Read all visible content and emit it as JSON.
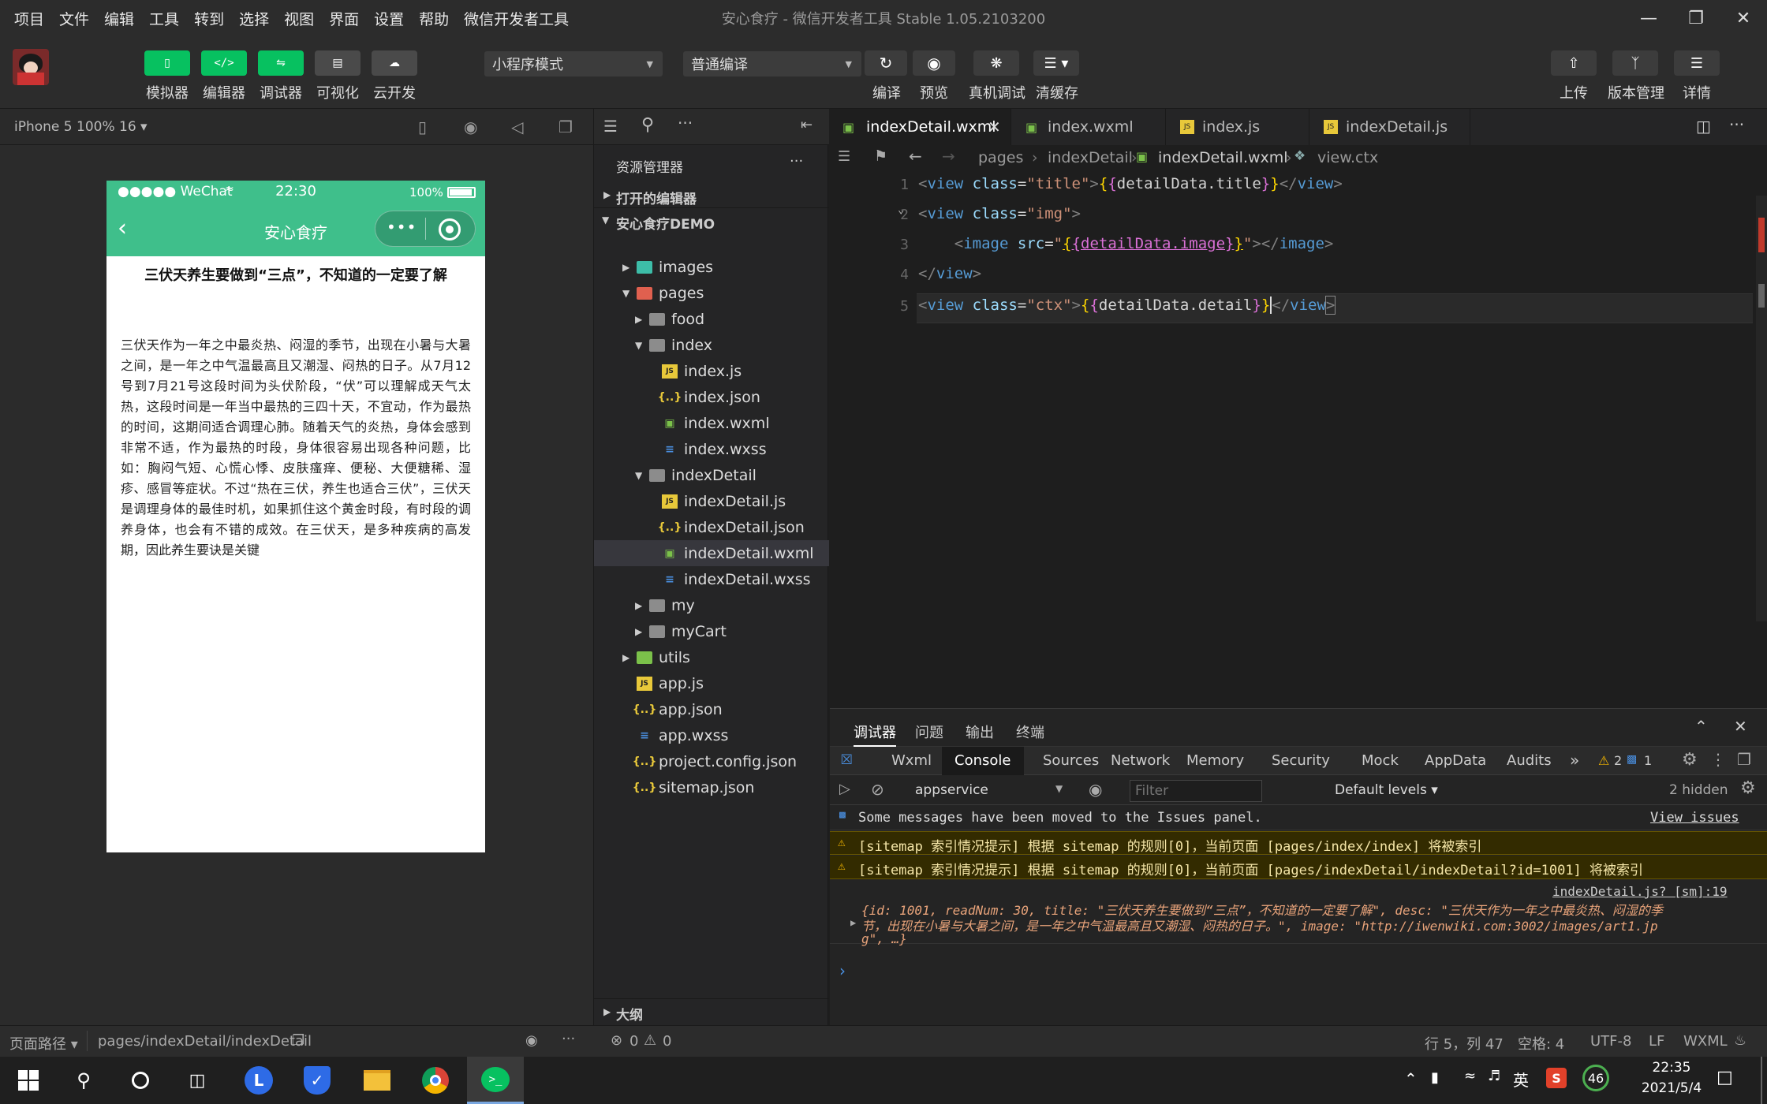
{
  "menu": [
    "项目",
    "文件",
    "编辑",
    "工具",
    "转到",
    "选择",
    "视图",
    "界面",
    "设置",
    "帮助",
    "微信开发者工具"
  ],
  "window_title": "安心食疗 - 微信开发者工具 Stable 1.05.2103200",
  "toolbar": {
    "left_buttons": [
      "模拟器",
      "编辑器",
      "调试器",
      "可视化",
      "云开发"
    ],
    "mode_select": "小程序模式",
    "compile_select": "普通编译",
    "actions": [
      "编译",
      "预览",
      "真机调试",
      "清缓存"
    ],
    "right_buttons": [
      "上传",
      "版本管理",
      "详情"
    ]
  },
  "simulator": {
    "device": "iPhone 5 100% 16 ▾",
    "status_left": "●●●●● WeChat",
    "status_time": "22:30",
    "status_battery": "100%",
    "nav_title": "安心食疗",
    "article_title": "三伏天养生要做到“三点”，不知道的一定要了解",
    "article_body": "三伏天作为一年之中最炎热、闷湿的季节，出现在小暑与大暑之间，是一年之中气温最高且又潮湿、闷热的日子。从7月12号到7月21号这段时间为头伏阶段，“伏”可以理解成天气太热，这段时间是一年当中最热的三四十天，不宜动，作为最热的时间，这期间适合调理心肺。随着天气的炎热，身体会感到非常不适，作为最热的时段，身体很容易出现各种问题，比如：胸闷气短、心慌心悸、皮肤瘙痒、便秘、大便糖稀、湿疹、感冒等症状。不过“热在三伏，养生也适合三伏”，三伏天是调理身体的最佳时机，如果抓住这个黄金时段，有时段的调养身体，也会有不错的成效。在三伏天，是多种疾病的高发期，因此养生要诀是关键"
  },
  "explorer": {
    "header": "资源管理器",
    "sections": [
      "打开的编辑器",
      "安心食疗DEMO",
      "大纲"
    ],
    "tree": [
      {
        "label": "images",
        "type": "folder",
        "depth": 1,
        "open": false,
        "color": "#3dbda8"
      },
      {
        "label": "pages",
        "type": "folder",
        "depth": 1,
        "open": true,
        "color": "#e0604f"
      },
      {
        "label": "food",
        "type": "folder",
        "depth": 2,
        "open": false
      },
      {
        "label": "index",
        "type": "folder",
        "depth": 2,
        "open": true
      },
      {
        "label": "index.js",
        "type": "js",
        "depth": 3
      },
      {
        "label": "index.json",
        "type": "json",
        "depth": 3
      },
      {
        "label": "index.wxml",
        "type": "wxml",
        "depth": 3
      },
      {
        "label": "index.wxss",
        "type": "wxss",
        "depth": 3
      },
      {
        "label": "indexDetail",
        "type": "folder",
        "depth": 2,
        "open": true
      },
      {
        "label": "indexDetail.js",
        "type": "js",
        "depth": 3
      },
      {
        "label": "indexDetail.json",
        "type": "json",
        "depth": 3
      },
      {
        "label": "indexDetail.wxml",
        "type": "wxml",
        "depth": 3,
        "selected": true
      },
      {
        "label": "indexDetail.wxss",
        "type": "wxss",
        "depth": 3
      },
      {
        "label": "my",
        "type": "folder",
        "depth": 2,
        "open": false
      },
      {
        "label": "myCart",
        "type": "folder",
        "depth": 2,
        "open": false
      },
      {
        "label": "utils",
        "type": "folder",
        "depth": 1,
        "open": false,
        "color": "#7bc14a"
      },
      {
        "label": "app.js",
        "type": "js",
        "depth": 1
      },
      {
        "label": "app.json",
        "type": "json",
        "depth": 1
      },
      {
        "label": "app.wxss",
        "type": "wxss",
        "depth": 1
      },
      {
        "label": "project.config.json",
        "type": "json",
        "depth": 1
      },
      {
        "label": "sitemap.json",
        "type": "json",
        "depth": 1
      }
    ]
  },
  "editor": {
    "tabs": [
      "indexDetail.wxml",
      "index.wxml",
      "index.js",
      "indexDetail.js"
    ],
    "breadcrumb": [
      "pages",
      "indexDetail",
      "indexDetail.wxml",
      "view.ctx"
    ],
    "line_numbers": [
      "1",
      "2",
      "3",
      "4",
      "5"
    ]
  },
  "devtools": {
    "top_tabs": [
      "调试器",
      "问题",
      "输出",
      "终端"
    ],
    "panel_tabs": [
      "Wxml",
      "Console",
      "Sources",
      "Network",
      "Memory",
      "Security",
      "Mock",
      "AppData",
      "Audits"
    ],
    "warn_count": "2",
    "info_count": "1",
    "context": "appservice",
    "filter_placeholder": "Filter",
    "levels": "Default levels ▾",
    "hidden": "2 hidden",
    "info_msg": "Some messages have been moved to the Issues panel.",
    "view_issues": "View issues",
    "warn1": "[sitemap 索引情况提示] 根据 sitemap 的规则[0]，当前页面 [pages/index/index] 将被索引",
    "warn2": "[sitemap 索引情况提示] 根据 sitemap 的规则[0]，当前页面 [pages/indexDetail/indexDetail?id=1001] 将被索引",
    "source_link": "indexDetail.js? [sm]:19",
    "obj_line1": "{id: 1001, readNum: 30, title: \"三伏天养生要做到“三点”，不知道的一定要了解\", desc: \"三伏天作为一年之中最炎热、闷湿的季",
    "obj_line2": "节，出现在小暑与大暑之间，是一年之中气温最高且又潮湿、闷热的日子。\", image: \"http://iwenwiki.com:3002/images/art1.jp",
    "obj_line3": "g\", …}"
  },
  "statusbar": {
    "page_path_label": "页面路径 ▾",
    "page_path": "pages/indexDetail/indexDetail",
    "errors": "0",
    "warnings": "0",
    "cursor": "行 5，列 47",
    "spaces": "空格: 4",
    "encoding": "UTF-8",
    "eol": "LF",
    "lang": "WXML"
  },
  "taskbar": {
    "ime": "英",
    "badge": "46",
    "time": "22:35",
    "date": "2021/5/4"
  },
  "colors": {
    "accent": "#07c160",
    "nav": "#3fbf8b",
    "tag": "#569cd6",
    "attr": "#9cdcfe",
    "string": "#ce9178",
    "brace": "#ffd700",
    "var": "#c586c0"
  }
}
